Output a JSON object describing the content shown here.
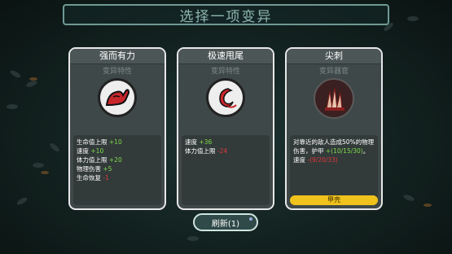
{
  "title": "选择一项变异",
  "cards": [
    {
      "name": "强而有力",
      "subtitle": "变异特性",
      "icon": "flexing-arm-icon",
      "stats": [
        {
          "label": "生命值上限 ",
          "value": "+10",
          "tone": "green"
        },
        {
          "label": "速度 ",
          "value": "+10",
          "tone": "green"
        },
        {
          "label": "体力值上限 ",
          "value": "+20",
          "tone": "green"
        },
        {
          "label": "物理伤害 ",
          "value": "+5",
          "tone": "green"
        },
        {
          "label": "生命恢复 ",
          "value": "-1",
          "tone": "red"
        }
      ]
    },
    {
      "name": "极速甩尾",
      "subtitle": "变异特性",
      "icon": "tail-swish-icon",
      "stats": [
        {
          "label": "速度 ",
          "value": "+36",
          "tone": "green"
        },
        {
          "label": "体力值上限 ",
          "value": "-24",
          "tone": "red"
        }
      ]
    },
    {
      "name": "尖刺",
      "subtitle": "变异器官",
      "icon": "spikes-icon",
      "desc_line1": "对靠近的敌人造成50%的物理",
      "desc_line2a": "伤害，护甲 ",
      "desc_line2b": "+(10/15/30)",
      "desc_line2c": "。",
      "desc_line3a": "速度 ",
      "desc_line3b": "-(9/20/33)",
      "tag": "甲壳"
    }
  ],
  "refresh_label": "刷新(1)",
  "colors": {
    "accent": "#f0c21c",
    "positive": "#7ddc4b",
    "negative": "#e0393a",
    "frame": "#6f9a94"
  }
}
